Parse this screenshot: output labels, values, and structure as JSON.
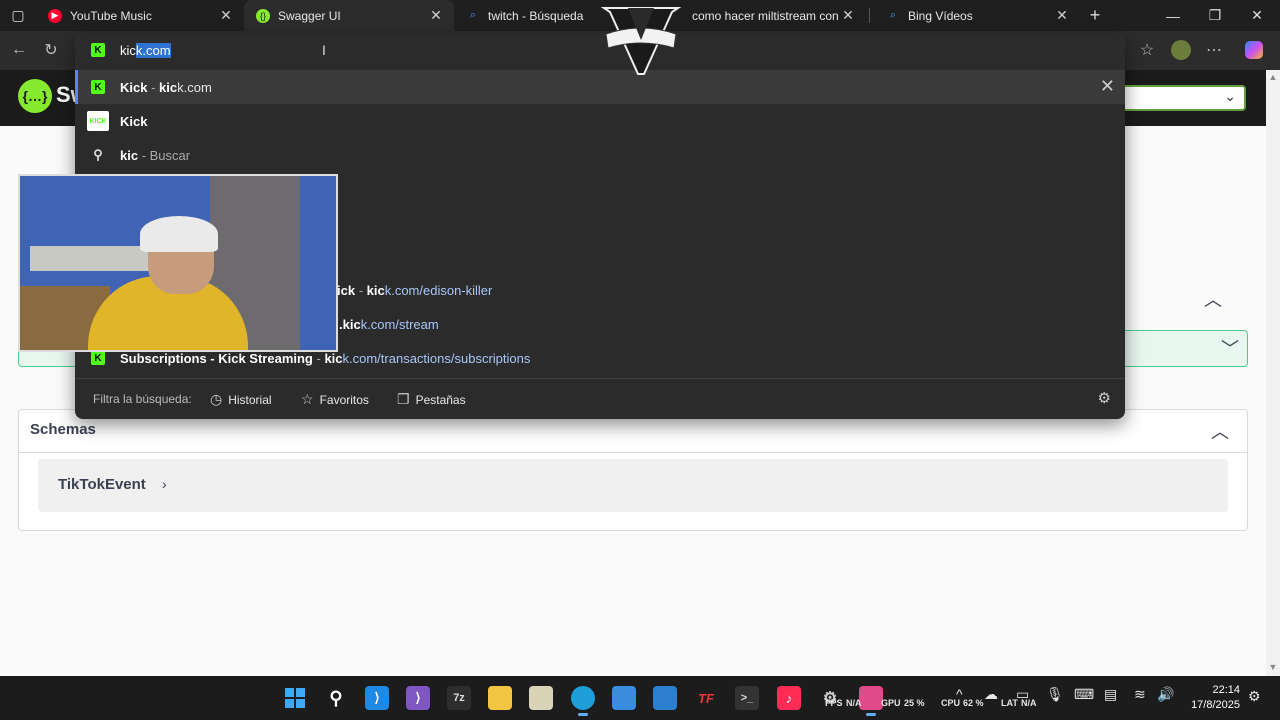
{
  "browser": {
    "tabs": [
      {
        "title": "YouTube Music",
        "favicon": "youtube-music-icon",
        "active": false
      },
      {
        "title": "Swagger UI",
        "favicon": "swagger-icon",
        "active": true
      },
      {
        "title": "twitch - Búsqueda",
        "favicon": "search-icon",
        "active": false
      },
      {
        "title": "como hacer miltistream con ar",
        "favicon": "",
        "active": false
      },
      {
        "title": "Bing Vídeos",
        "favicon": "search-icon",
        "active": false
      }
    ],
    "new_tab_glyph": "+",
    "close_glyph": "✕"
  },
  "omnibox": {
    "typed": "kic",
    "autocomplete": "k.com",
    "suggestions": [
      {
        "bold": "Kick",
        "sep": " - ",
        "url_bold": "kic",
        "url_rest": "k.com",
        "icon": "kick-k-icon",
        "highlighted": true
      },
      {
        "bold": "Kick",
        "sep": "",
        "url_bold": "",
        "url_rest": "",
        "icon": "kick-logo-icon",
        "highlighted": false
      },
      {
        "bold": "kic",
        "sep": " - ",
        "url_bold": "",
        "url_rest": "Buscar",
        "icon": "search-icon",
        "highlighted": false
      },
      {
        "bold": "ick",
        "sep": " - ",
        "url_bold": "kic",
        "url_rest": "k.com/edison-killer",
        "icon": "kick-k-icon",
        "highlighted": false
      },
      {
        "bold": "",
        "sep": "",
        "url_bold": ".kic",
        "url_rest": "k.com/stream",
        "icon": "kick-k-icon",
        "highlighted": false
      },
      {
        "bold": "Subscriptions - Kick Streaming",
        "sep": " - ",
        "url_bold": "kic",
        "url_rest": "k.com/transactions/subscriptions",
        "icon": "kick-k-icon",
        "highlighted": false
      }
    ],
    "filter_label": "Filtra la búsqueda:",
    "filters": [
      "Historial",
      "Favoritos",
      "Pestañas"
    ]
  },
  "swagger": {
    "logo_text": "Sw",
    "schemas_title": "Schemas",
    "model_name": "TikTokEvent"
  },
  "taskbar": {
    "fps_label": "FPS",
    "fps_value": "N/A",
    "gpu_label": "GPU",
    "gpu_value": "25 %",
    "cpu_label": "CPU",
    "cpu_value": "62 %",
    "lat_label": "LAT",
    "lat_value": "N/A",
    "time": "22:14",
    "date": "17/8/2025"
  },
  "colors": {
    "kick_green": "#53fc18",
    "swagger_green": "#85ea2d",
    "selection_blue": "#2f72d0",
    "url_blue": "#a8c7fa"
  }
}
